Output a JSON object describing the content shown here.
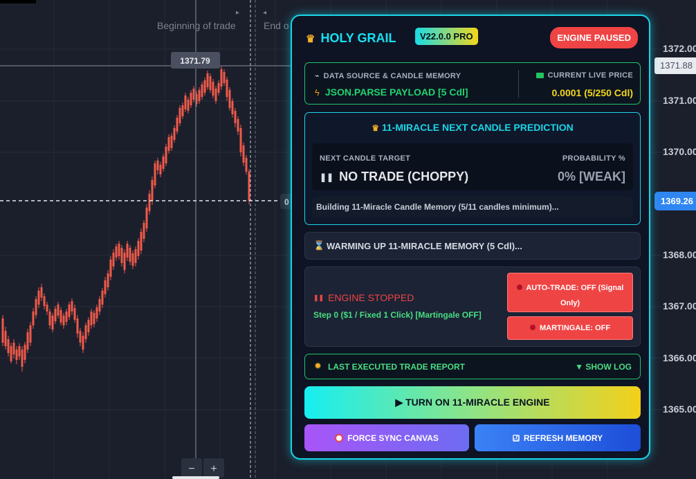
{
  "chart": {
    "markers": {
      "start": "Beginning of trade",
      "end": "End o"
    },
    "crosshair_price": "1371.79",
    "current_price_tag": "1369.26",
    "last_price_tag": "1371.88",
    "dashed_label": "0",
    "price_axis": [
      "1372.00",
      "1371.00",
      "1370.00",
      "1368.00",
      "1367.00",
      "1366.00",
      "1365.00"
    ],
    "zoom": {
      "minus": "−",
      "plus": "+"
    },
    "colors": {
      "up": "#22c55e",
      "down": "#ef5a4a",
      "bg": "#1b1f2c"
    }
  },
  "panel": {
    "title": "HOLY GRAIL",
    "title_icon": "crown-icon",
    "version": "V22.0.0 PRO",
    "status_badge": "ENGINE PAUSED",
    "source": {
      "label": "DATA SOURCE & CANDLE MEMORY",
      "value": "JSON.PARSE PAYLOAD [5 Cdl]",
      "price_label": "CURRENT LIVE PRICE",
      "price_value": "0.0001 (5/250 Cdl)"
    },
    "prediction": {
      "title": "11-MIRACLE NEXT CANDLE PREDICTION",
      "target_label": "NEXT CANDLE TARGET",
      "target_value": "NO TRADE (CHOPPY)",
      "prob_label": "PROBABILITY %",
      "prob_value": "0% [WEAK]",
      "status": "Building 11-Miracle Candle Memory (5/11 candles minimum)..."
    },
    "warming": "WARMING UP 11-MIRACLE MEMORY (5 Cdl)...",
    "engine": {
      "state": "ENGINE STOPPED",
      "step": "Step 0 ($1 / Fixed 1 Click) [Martingale OFF]",
      "auto_trade": "AUTO-TRADE: OFF (Signal Only)",
      "martingale": "MARTINGALE: OFF"
    },
    "report": {
      "label": "LAST EXECUTED TRADE REPORT",
      "toggle": "▼ SHOW LOG"
    },
    "turn_on": "▶ TURN ON 11-MIRACLE ENGINE",
    "force_sync": "FORCE SYNC CANVAS",
    "refresh": "REFRESH MEMORY",
    "colors": {
      "accent": "#19d6e8",
      "green": "#21c66a",
      "red": "#ef4444",
      "yellow": "#f3d61b"
    }
  }
}
